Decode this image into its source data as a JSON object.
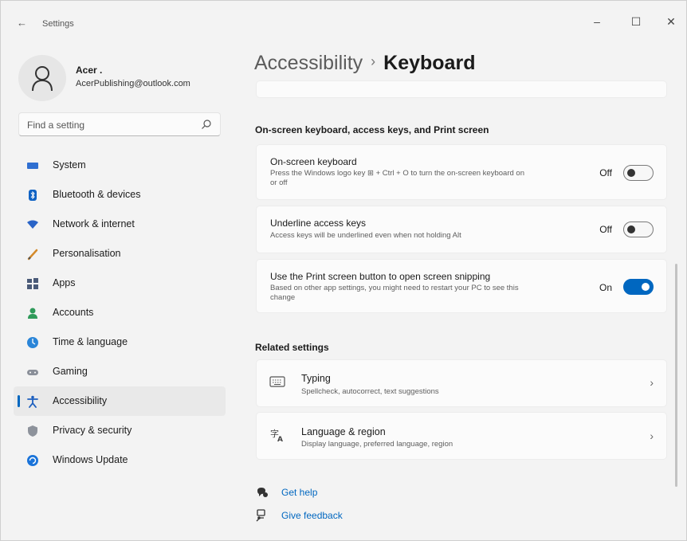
{
  "window": {
    "title": "Settings",
    "back": "←",
    "minimize": "–",
    "maximize": "☐",
    "close": "✕"
  },
  "profile": {
    "name": "Acer .",
    "email": "AcerPublishing@outlook.com"
  },
  "search": {
    "placeholder": "Find a setting"
  },
  "sidebar": {
    "items": [
      {
        "label": "System",
        "icon": "system-icon"
      },
      {
        "label": "Bluetooth & devices",
        "icon": "bluetooth-icon"
      },
      {
        "label": "Network & internet",
        "icon": "network-icon"
      },
      {
        "label": "Personalisation",
        "icon": "personalisation-icon"
      },
      {
        "label": "Apps",
        "icon": "apps-icon"
      },
      {
        "label": "Accounts",
        "icon": "accounts-icon"
      },
      {
        "label": "Time & language",
        "icon": "time-language-icon"
      },
      {
        "label": "Gaming",
        "icon": "gaming-icon"
      },
      {
        "label": "Accessibility",
        "icon": "accessibility-icon",
        "selected": true
      },
      {
        "label": "Privacy & security",
        "icon": "privacy-icon"
      },
      {
        "label": "Windows Update",
        "icon": "windows-update-icon"
      }
    ]
  },
  "breadcrumb": {
    "parent": "Accessibility",
    "separator": "›",
    "current": "Keyboard"
  },
  "section1": {
    "heading": "On-screen keyboard, access keys, and Print screen",
    "settings": [
      {
        "title": "On-screen keyboard",
        "description": "Press the Windows logo key ⊞ + Ctrl + O to turn the on-screen keyboard on or off",
        "state": "Off",
        "on": false
      },
      {
        "title": "Underline access keys",
        "description": "Access keys will be underlined even when not holding Alt",
        "state": "Off",
        "on": false
      },
      {
        "title": "Use the Print screen button to open screen snipping",
        "description": "Based on other app settings, you might need to restart your PC to see this change",
        "state": "On",
        "on": true
      }
    ]
  },
  "related": {
    "heading": "Related settings",
    "items": [
      {
        "title": "Typing",
        "description": "Spellcheck, autocorrect, text suggestions",
        "icon": "keyboard-icon"
      },
      {
        "title": "Language & region",
        "description": "Display language, preferred language, region",
        "icon": "language-icon"
      }
    ],
    "chevron": "›"
  },
  "help": {
    "get_help": "Get help",
    "give_feedback": "Give feedback"
  },
  "colors": {
    "accent": "#0067c0",
    "background": "#f3f3f3",
    "card": "#fbfbfb"
  }
}
